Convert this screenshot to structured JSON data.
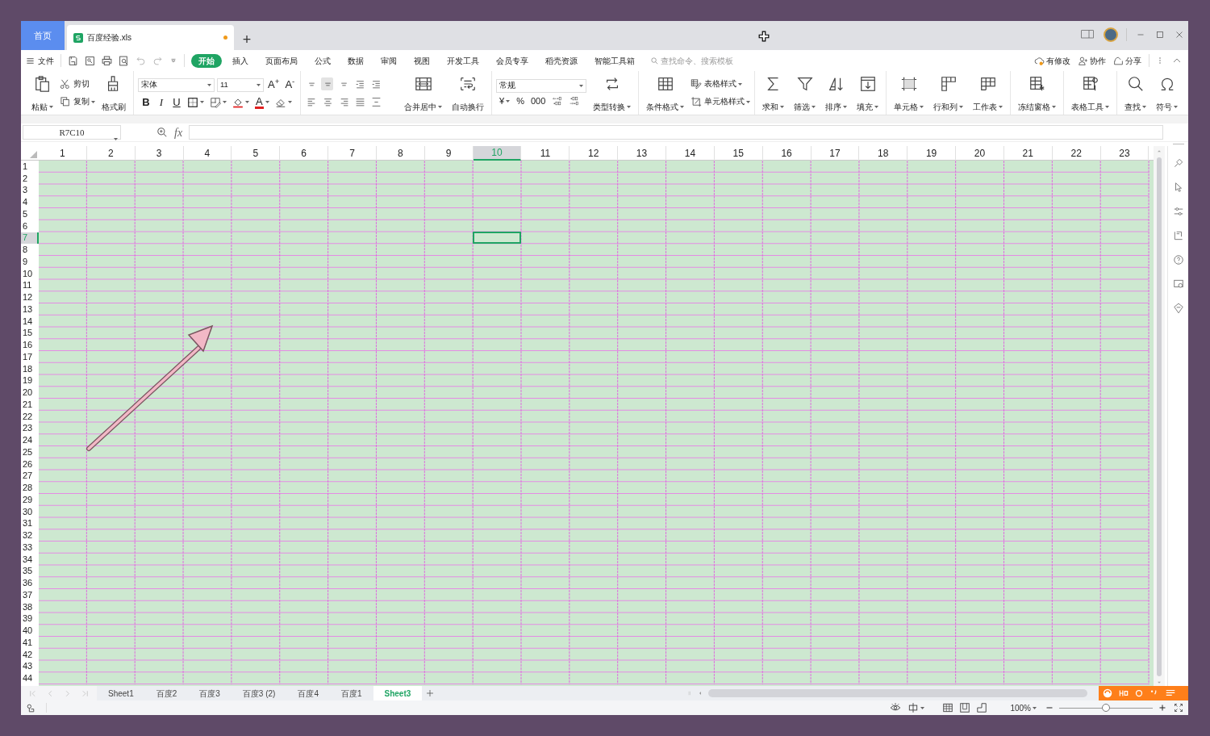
{
  "title_bar": {
    "home_tab": "首页",
    "document_tab": {
      "title": "百度经验.xls",
      "unsaved": true
    },
    "new_tab": "+"
  },
  "menu": {
    "file": "文件",
    "tabs": [
      {
        "label": "开始",
        "selected": true
      },
      {
        "label": "插入",
        "selected": false
      },
      {
        "label": "页面布局",
        "selected": false
      },
      {
        "label": "公式",
        "selected": false
      },
      {
        "label": "数据",
        "selected": false
      },
      {
        "label": "审阅",
        "selected": false
      },
      {
        "label": "视图",
        "selected": false
      },
      {
        "label": "开发工具",
        "selected": false
      },
      {
        "label": "会员专享",
        "selected": false
      },
      {
        "label": "稻壳资源",
        "selected": false
      },
      {
        "label": "智能工具箱",
        "selected": false
      }
    ],
    "search": {
      "placeholder": "查找命令、搜索模板"
    },
    "actions": [
      "有修改",
      "协作",
      "分享"
    ]
  },
  "ribbon": {
    "groups": [
      {
        "items": [
          {
            "kind": "large",
            "label": "粘贴",
            "dropdown": true
          },
          {
            "kind": "stack",
            "children": [
              {
                "label": "剪切",
                "dropdown": false
              },
              {
                "label": "复制",
                "dropdown": true
              }
            ]
          },
          {
            "kind": "large",
            "label": "格式刷",
            "dropdown": false
          }
        ]
      },
      {
        "items": [
          {
            "kind": "font",
            "font_name": "宋体",
            "font_size": "11",
            "grow": "A$^{+}$",
            "shrink": "A$^{-}$",
            "styles": [
              "B",
              "I",
              "U"
            ],
            "font_color": "A"
          }
        ]
      },
      {
        "items": [
          {
            "kind": "align"
          },
          {
            "kind": "large",
            "label": "合并居中",
            "dropdown": true
          },
          {
            "kind": "large",
            "label": "自动换行",
            "dropdown": false
          }
        ]
      },
      {
        "items": [
          {
            "kind": "number",
            "format": "常规",
            "symbols": [
              "¥",
              "%",
              "000"
            ]
          },
          {
            "kind": "large",
            "label": "类型转换",
            "dropdown": true
          }
        ]
      },
      {
        "items": [
          {
            "kind": "large",
            "label": "条件格式",
            "dropdown": true
          },
          {
            "kind": "stack",
            "children": [
              {
                "label": "表格样式",
                "dropdown": true
              },
              {
                "label": "单元格样式",
                "dropdown": true
              }
            ]
          }
        ]
      },
      {
        "items": [
          {
            "kind": "large",
            "label": "求和",
            "dropdown": true
          },
          {
            "kind": "large",
            "label": "筛选",
            "dropdown": true
          },
          {
            "kind": "large",
            "label": "排序",
            "dropdown": true
          },
          {
            "kind": "large",
            "label": "填充",
            "dropdown": true
          }
        ]
      },
      {
        "items": [
          {
            "kind": "large",
            "label": "单元格",
            "dropdown": true
          },
          {
            "kind": "large",
            "label": "行和列",
            "dropdown": true
          },
          {
            "kind": "large",
            "label": "工作表",
            "dropdown": true
          }
        ]
      },
      {
        "items": [
          {
            "kind": "large",
            "label": "冻结窗格",
            "dropdown": true
          }
        ]
      },
      {
        "items": [
          {
            "kind": "large",
            "label": "表格工具",
            "dropdown": true
          }
        ]
      },
      {
        "items": [
          {
            "kind": "large",
            "label": "查找",
            "dropdown": true
          },
          {
            "kind": "large",
            "label": "符号",
            "dropdown": true
          }
        ]
      }
    ]
  },
  "formula_bar": {
    "name_box": "R7C10",
    "fx": "fx"
  },
  "sheet": {
    "columns": [
      {
        "label": "1",
        "selected": false
      },
      {
        "label": "2",
        "selected": false
      },
      {
        "label": "3",
        "selected": false
      },
      {
        "label": "4",
        "selected": false
      },
      {
        "label": "5",
        "selected": false
      },
      {
        "label": "6",
        "selected": false
      },
      {
        "label": "7",
        "selected": false
      },
      {
        "label": "8",
        "selected": false
      },
      {
        "label": "9",
        "selected": false
      },
      {
        "label": "10",
        "selected": true
      },
      {
        "label": "11",
        "selected": false
      },
      {
        "label": "12",
        "selected": false
      },
      {
        "label": "13",
        "selected": false
      },
      {
        "label": "14",
        "selected": false
      },
      {
        "label": "15",
        "selected": false
      },
      {
        "label": "16",
        "selected": false
      },
      {
        "label": "17",
        "selected": false
      },
      {
        "label": "18",
        "selected": false
      },
      {
        "label": "19",
        "selected": false
      },
      {
        "label": "20",
        "selected": false
      },
      {
        "label": "21",
        "selected": false
      },
      {
        "label": "22",
        "selected": false
      },
      {
        "label": "23",
        "selected": false
      }
    ],
    "rows": [
      {
        "label": "1",
        "selected": false
      },
      {
        "label": "2",
        "selected": false
      },
      {
        "label": "3",
        "selected": false
      },
      {
        "label": "4",
        "selected": false
      },
      {
        "label": "5",
        "selected": false
      },
      {
        "label": "6",
        "selected": false
      },
      {
        "label": "7",
        "selected": true
      },
      {
        "label": "8",
        "selected": false
      },
      {
        "label": "9",
        "selected": false
      },
      {
        "label": "10",
        "selected": false
      },
      {
        "label": "11",
        "selected": false
      },
      {
        "label": "12",
        "selected": false
      },
      {
        "label": "13",
        "selected": false
      },
      {
        "label": "14",
        "selected": false
      },
      {
        "label": "15",
        "selected": false
      },
      {
        "label": "16",
        "selected": false
      },
      {
        "label": "17",
        "selected": false
      },
      {
        "label": "18",
        "selected": false
      },
      {
        "label": "19",
        "selected": false
      },
      {
        "label": "20",
        "selected": false
      },
      {
        "label": "21",
        "selected": false
      },
      {
        "label": "22",
        "selected": false
      },
      {
        "label": "23",
        "selected": false
      },
      {
        "label": "24",
        "selected": false
      },
      {
        "label": "25",
        "selected": false
      },
      {
        "label": "26",
        "selected": false
      },
      {
        "label": "27",
        "selected": false
      },
      {
        "label": "28",
        "selected": false
      },
      {
        "label": "29",
        "selected": false
      },
      {
        "label": "30",
        "selected": false
      },
      {
        "label": "31",
        "selected": false
      },
      {
        "label": "32",
        "selected": false
      },
      {
        "label": "33",
        "selected": false
      },
      {
        "label": "34",
        "selected": false
      },
      {
        "label": "35",
        "selected": false
      },
      {
        "label": "36",
        "selected": false
      },
      {
        "label": "37",
        "selected": false
      },
      {
        "label": "38",
        "selected": false
      },
      {
        "label": "39",
        "selected": false
      },
      {
        "label": "40",
        "selected": false
      },
      {
        "label": "41",
        "selected": false
      },
      {
        "label": "42",
        "selected": false
      },
      {
        "label": "43",
        "selected": false
      },
      {
        "label": "44",
        "selected": false
      }
    ]
  },
  "sheet_tabs": [
    {
      "label": "Sheet1",
      "selected": false
    },
    {
      "label": "百度2",
      "selected": false
    },
    {
      "label": "百度3",
      "selected": false
    },
    {
      "label": "百度3 (2)",
      "selected": false
    },
    {
      "label": "百度4",
      "selected": false
    },
    {
      "label": "百度1",
      "selected": false
    },
    {
      "label": "Sheet3",
      "selected": true
    }
  ],
  "status_bar": {
    "zoom": "100%",
    "zoom_slider": {
      "level": 0.5
    }
  }
}
